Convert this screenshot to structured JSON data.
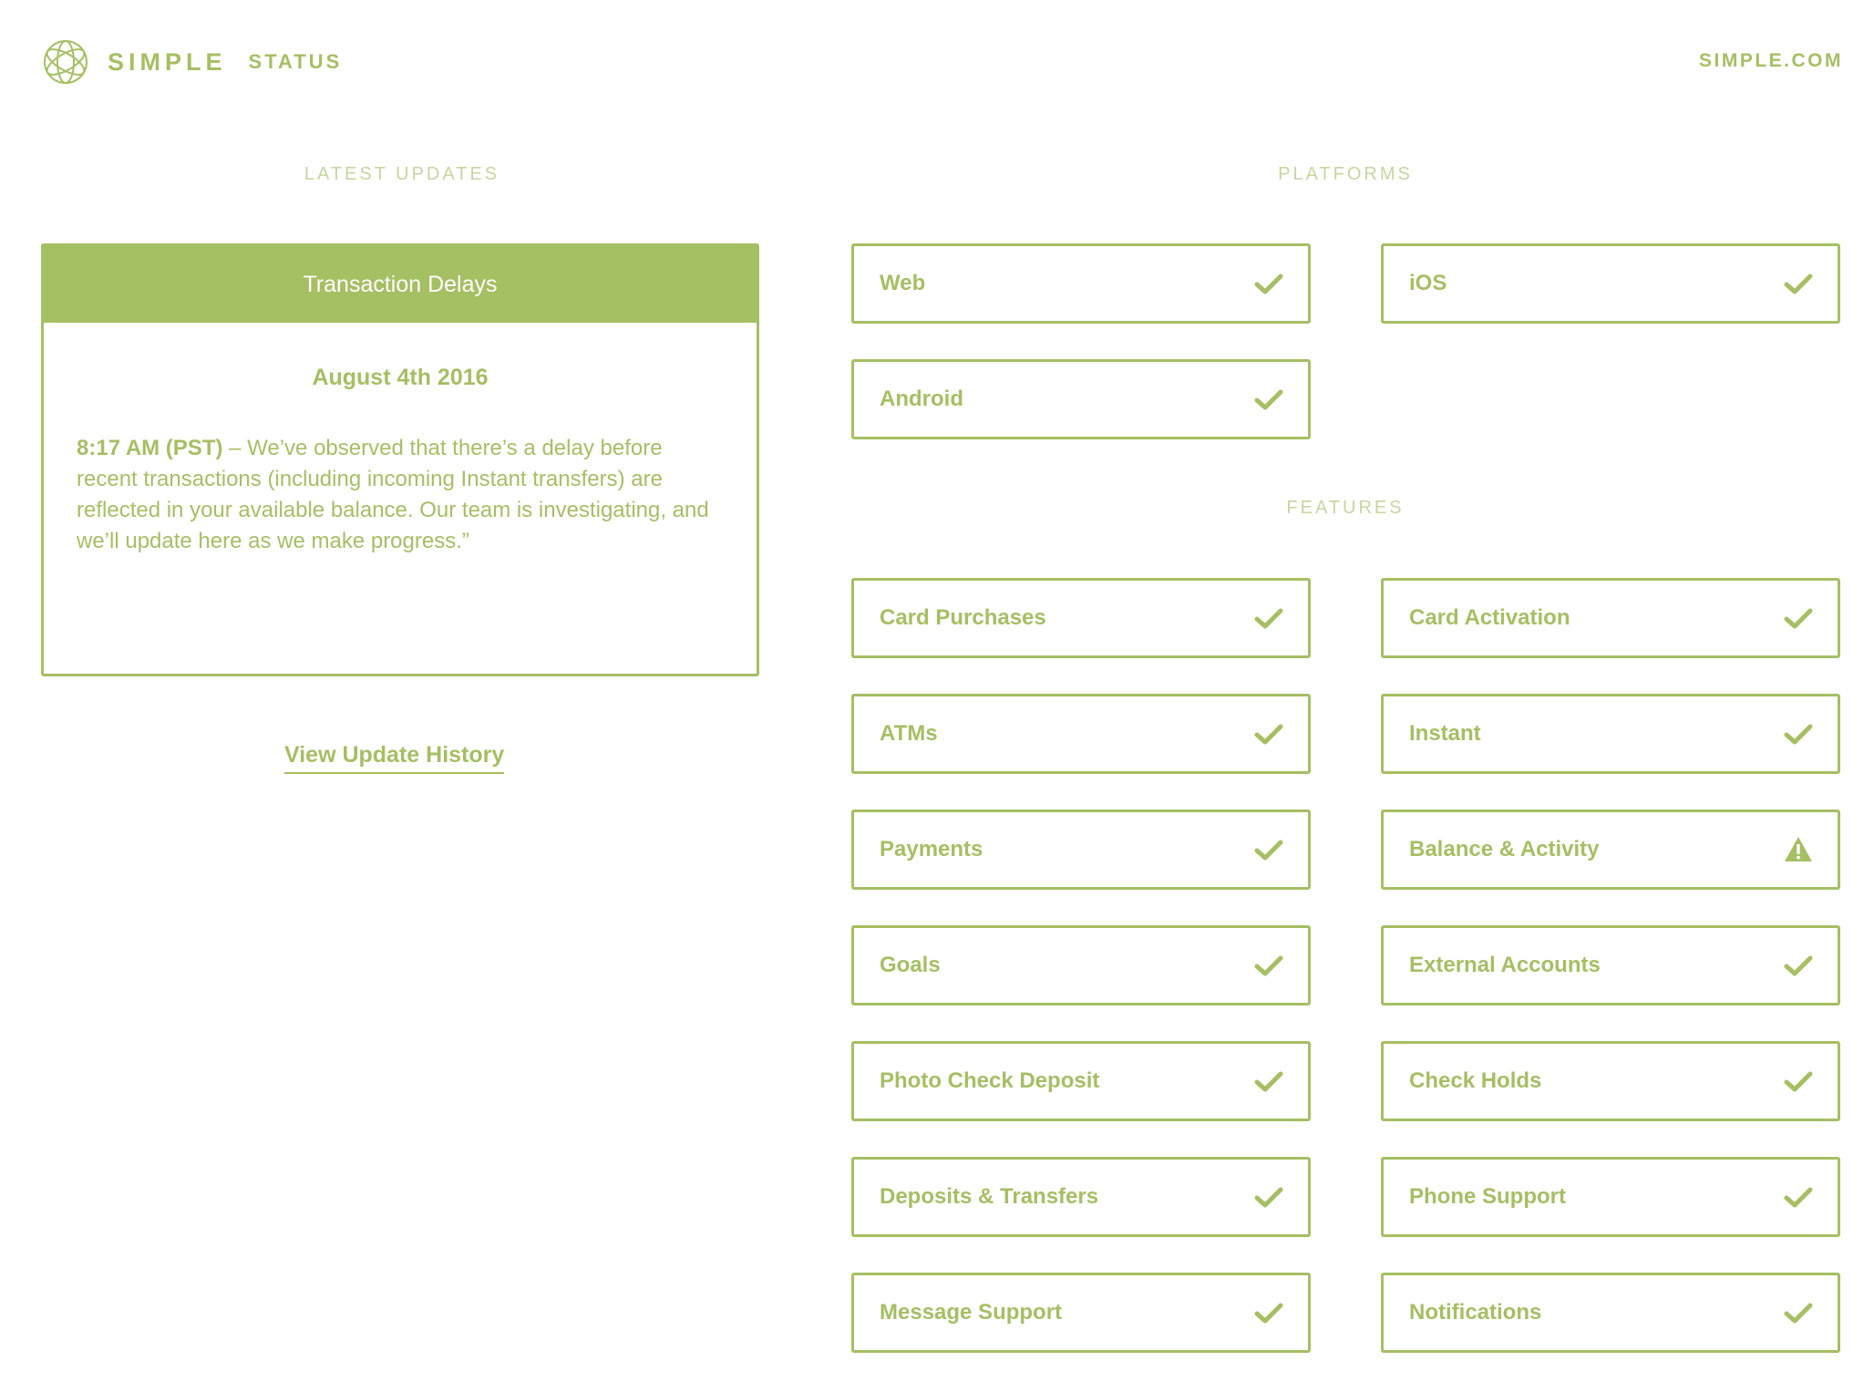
{
  "header": {
    "brand": "SIMPLE",
    "section": "STATUS",
    "site_link": "SIMPLE.COM",
    "accent_color": "#a5bf63"
  },
  "updates": {
    "title": "LATEST UPDATES",
    "card_title": "Transaction Delays",
    "date": "August 4th 2016",
    "time": "8:17 AM (PST)",
    "message": " – We’ve observed that there’s a delay before recent transactions (including incoming Instant transfers) are reflected in your available balance. Our team is investigating, and we’ll update here as we make progress.”",
    "history_link": "View Update History"
  },
  "platforms": {
    "title": "PLATFORMS",
    "items": [
      {
        "label": "Web",
        "status": "ok",
        "icon": "check-icon"
      },
      {
        "label": "iOS",
        "status": "ok",
        "icon": "check-icon"
      },
      {
        "label": "Android",
        "status": "ok",
        "icon": "check-icon"
      }
    ]
  },
  "features": {
    "title": "FEATURES",
    "items": [
      {
        "label": "Card Purchases",
        "status": "ok",
        "icon": "check-icon"
      },
      {
        "label": "Card Activation",
        "status": "ok",
        "icon": "check-icon"
      },
      {
        "label": "ATMs",
        "status": "ok",
        "icon": "check-icon"
      },
      {
        "label": "Instant",
        "status": "ok",
        "icon": "check-icon"
      },
      {
        "label": "Payments",
        "status": "ok",
        "icon": "check-icon"
      },
      {
        "label": "Balance & Activity",
        "status": "warning",
        "icon": "warning-icon"
      },
      {
        "label": "Goals",
        "status": "ok",
        "icon": "check-icon"
      },
      {
        "label": "External Accounts",
        "status": "ok",
        "icon": "check-icon"
      },
      {
        "label": "Photo Check Deposit",
        "status": "ok",
        "icon": "check-icon"
      },
      {
        "label": "Check Holds",
        "status": "ok",
        "icon": "check-icon"
      },
      {
        "label": "Deposits & Transfers",
        "status": "ok",
        "icon": "check-icon"
      },
      {
        "label": "Phone Support",
        "status": "ok",
        "icon": "check-icon"
      },
      {
        "label": "Message Support",
        "status": "ok",
        "icon": "check-icon"
      },
      {
        "label": "Notifications",
        "status": "ok",
        "icon": "check-icon"
      }
    ]
  }
}
